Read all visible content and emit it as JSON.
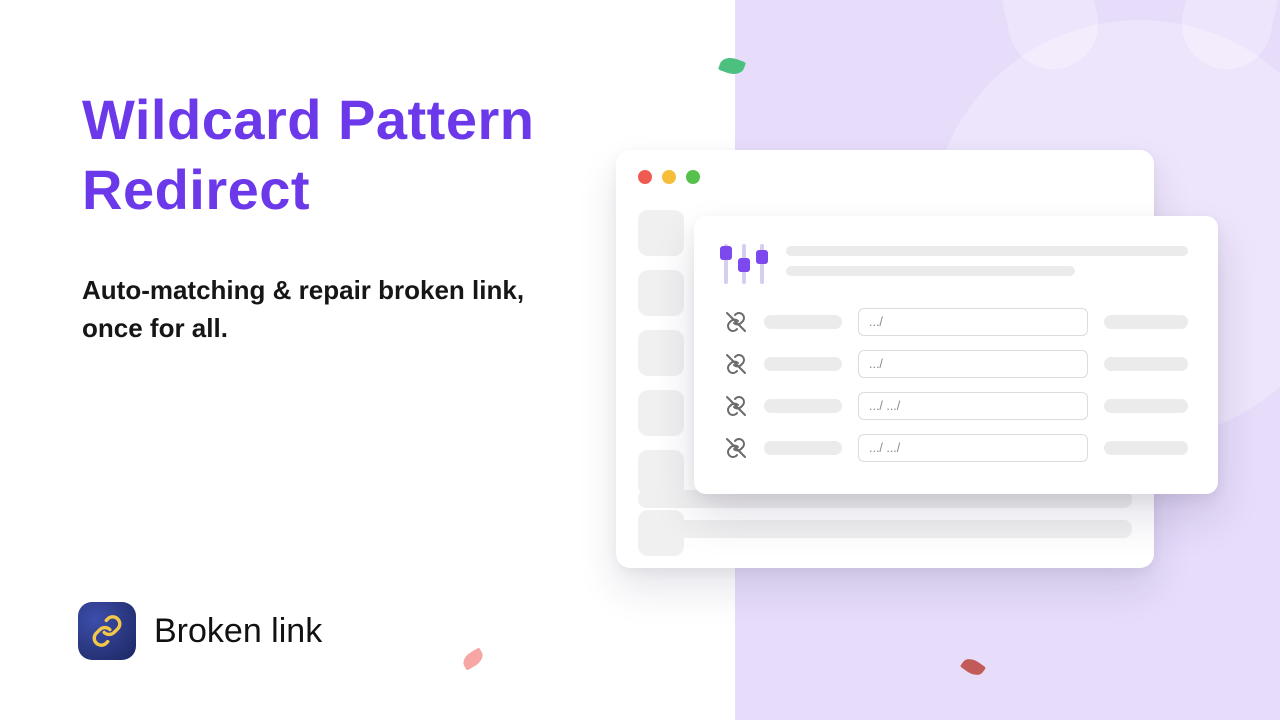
{
  "heading": "Wildcard Pattern Redirect",
  "subheading": "Auto-matching & repair broken link, once for all.",
  "brand": {
    "name": "Broken link"
  },
  "panel": {
    "rows": [
      {
        "pattern": ".../"
      },
      {
        "pattern": ".../"
      },
      {
        "pattern": ".../ .../"
      },
      {
        "pattern": ".../ .../"
      }
    ]
  },
  "colors": {
    "accent": "#6b39ea",
    "lavender": "#e7dcfa"
  }
}
